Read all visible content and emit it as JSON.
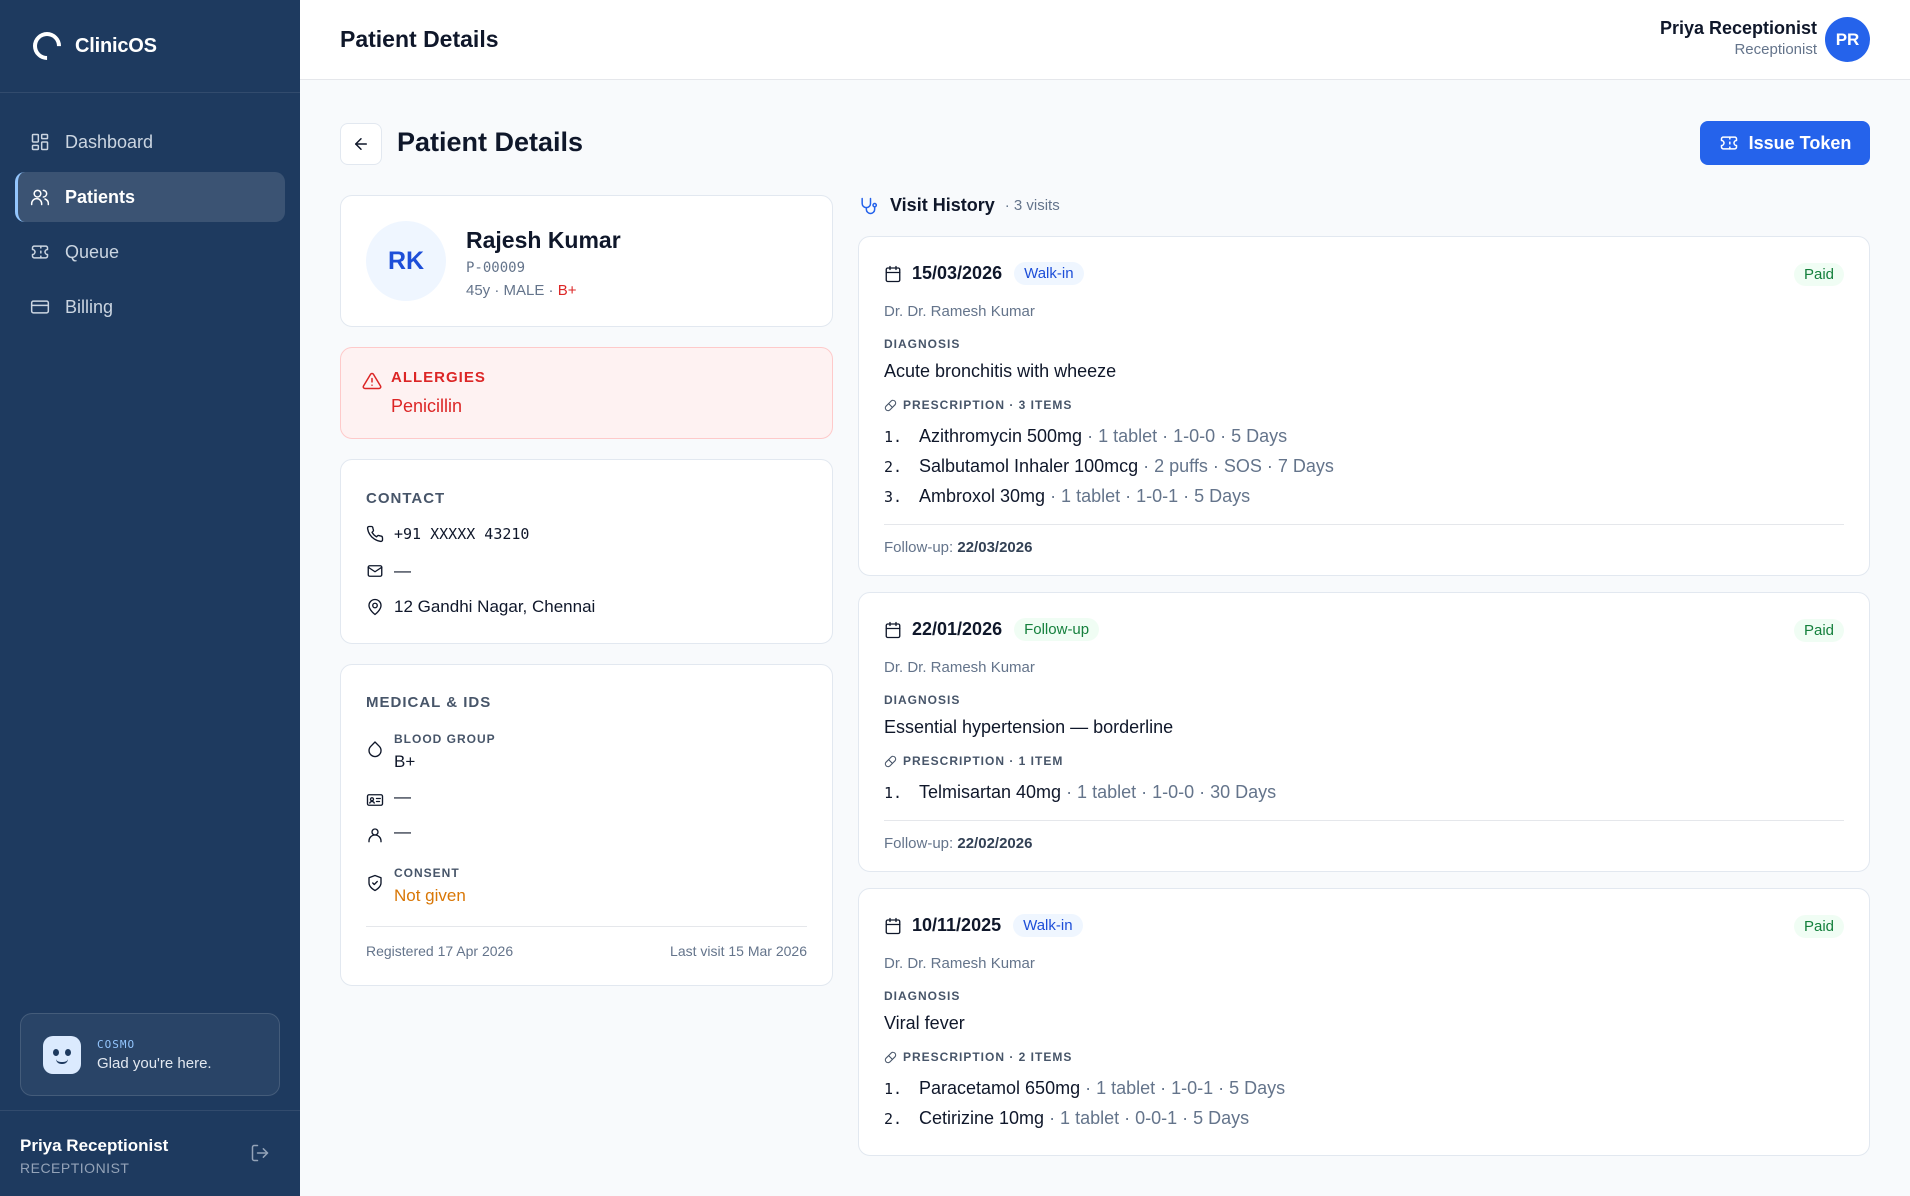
{
  "app": {
    "name": "ClinicOS"
  },
  "sidebar": {
    "items": [
      {
        "label": "Dashboard",
        "icon": "dashboard-icon"
      },
      {
        "label": "Patients",
        "icon": "users-icon",
        "active": true
      },
      {
        "label": "Queue",
        "icon": "ticket-icon"
      },
      {
        "label": "Billing",
        "icon": "credit-card-icon"
      }
    ],
    "assistant": {
      "label": "COSMO",
      "message": "Glad you're here."
    },
    "user": {
      "name": "Priya Receptionist",
      "role": "RECEPTIONIST"
    }
  },
  "topbar": {
    "title": "Patient Details",
    "user": {
      "name": "Priya Receptionist",
      "role": "Receptionist",
      "initials": "PR"
    }
  },
  "page": {
    "title": "Patient Details",
    "issue_token_label": "Issue Token"
  },
  "patient": {
    "initials": "RK",
    "name": "Rajesh Kumar",
    "id": "P-00009",
    "meta": "45y · MALE · ",
    "blood_badge": "B+"
  },
  "allergies": {
    "label": "ALLERGIES",
    "value": "Penicillin"
  },
  "contact": {
    "label": "CONTACT",
    "phone": "+91 XXXXX 43210",
    "email": "—",
    "address": "12 Gandhi Nagar, Chennai"
  },
  "medical": {
    "label": "MEDICAL & IDS",
    "blood_group_label": "BLOOD GROUP",
    "blood_group": "B+",
    "id_card": "—",
    "guardian": "—",
    "consent_label": "CONSENT",
    "consent": "Not given",
    "registered": "Registered 17 Apr 2026",
    "last_visit": "Last visit 15 Mar 2026"
  },
  "visit_history": {
    "title": "Visit History",
    "count": "· 3 visits",
    "visits": [
      {
        "date": "15/03/2026",
        "type": "Walk-in",
        "status": "Paid",
        "doctor": "Dr. Dr. Ramesh Kumar",
        "diagnosis_label": "DIAGNOSIS",
        "diagnosis": "Acute bronchitis with wheeze",
        "prescription_label": "PRESCRIPTION · 3 ITEMS",
        "items": [
          {
            "num": "1.",
            "name": "Azithromycin 500mg",
            "detail": "· 1 tablet · 1-0-0 · 5 Days"
          },
          {
            "num": "2.",
            "name": "Salbutamol Inhaler 100mcg",
            "detail": "· 2 puffs · SOS · 7 Days"
          },
          {
            "num": "3.",
            "name": "Ambroxol 30mg",
            "detail": "· 1 tablet · 1-0-1 · 5 Days"
          }
        ],
        "followup_label": "Follow-up:",
        "followup": "22/03/2026"
      },
      {
        "date": "22/01/2026",
        "type": "Follow-up",
        "status": "Paid",
        "doctor": "Dr. Dr. Ramesh Kumar",
        "diagnosis_label": "DIAGNOSIS",
        "diagnosis": "Essential hypertension — borderline",
        "prescription_label": "PRESCRIPTION · 1 ITEM",
        "items": [
          {
            "num": "1.",
            "name": "Telmisartan 40mg",
            "detail": "· 1 tablet · 1-0-0 · 30 Days"
          }
        ],
        "followup_label": "Follow-up:",
        "followup": "22/02/2026"
      },
      {
        "date": "10/11/2025",
        "type": "Walk-in",
        "status": "Paid",
        "doctor": "Dr. Dr. Ramesh Kumar",
        "diagnosis_label": "DIAGNOSIS",
        "diagnosis": "Viral fever",
        "prescription_label": "PRESCRIPTION · 2 ITEMS",
        "items": [
          {
            "num": "1.",
            "name": "Paracetamol 650mg",
            "detail": "· 1 tablet · 1-0-1 · 5 Days"
          },
          {
            "num": "2.",
            "name": "Cetirizine 10mg",
            "detail": "· 1 tablet · 0-0-1 · 5 Days"
          }
        ]
      }
    ]
  },
  "colors": {
    "sidebar": "#1e3a5f",
    "primary": "#2563eb",
    "danger": "#dc2626",
    "warning": "#d97706",
    "success": "#15803d"
  }
}
